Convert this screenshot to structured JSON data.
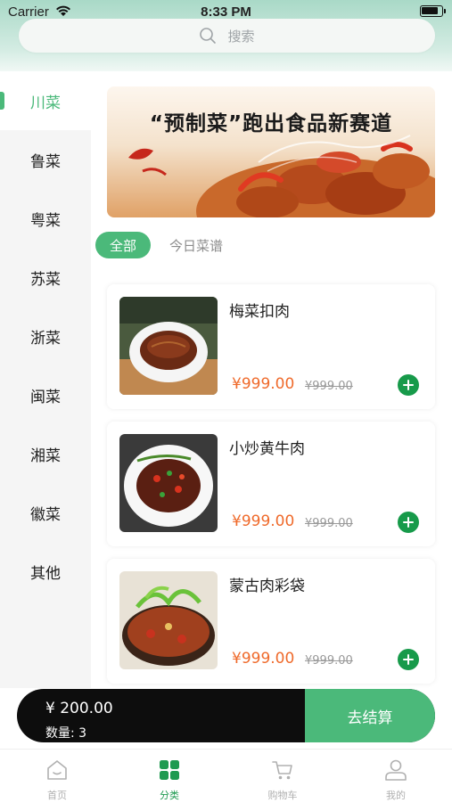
{
  "status_bar": {
    "carrier": "Carrier",
    "time": "8:33 PM"
  },
  "search": {
    "placeholder": "搜索"
  },
  "sidebar": {
    "items": [
      {
        "label": "川菜",
        "active": true
      },
      {
        "label": "鲁菜"
      },
      {
        "label": "粤菜"
      },
      {
        "label": "苏菜"
      },
      {
        "label": "浙菜"
      },
      {
        "label": "闽菜"
      },
      {
        "label": "湘菜"
      },
      {
        "label": "徽菜"
      },
      {
        "label": "其他"
      }
    ]
  },
  "banner": {
    "title": "“预制菜”跑出食品新赛道"
  },
  "tabs": {
    "all": "全部",
    "today": "今日菜谱"
  },
  "products": [
    {
      "name": "梅菜扣肉",
      "price": "¥999.00",
      "old_price": "¥999.00"
    },
    {
      "name": "小炒黄牛肉",
      "price": "¥999.00",
      "old_price": "¥999.00"
    },
    {
      "name": "蒙古肉彩袋",
      "price": "¥999.00",
      "old_price": "¥999.00"
    }
  ],
  "checkout": {
    "total": "¥ 200.00",
    "quantity": "数量: 3",
    "button": "去结算"
  },
  "tabbar": {
    "items": [
      {
        "label": "首页",
        "icon": "home-icon"
      },
      {
        "label": "分类",
        "icon": "category-icon",
        "active": true
      },
      {
        "label": "购物车",
        "icon": "cart-icon"
      },
      {
        "label": "我的",
        "icon": "profile-icon"
      }
    ]
  },
  "colors": {
    "accent": "#4bb97a",
    "price": "#ef6a2b",
    "checkout_bg": "#0d0d0d",
    "tab_active": "#1e9a50"
  }
}
